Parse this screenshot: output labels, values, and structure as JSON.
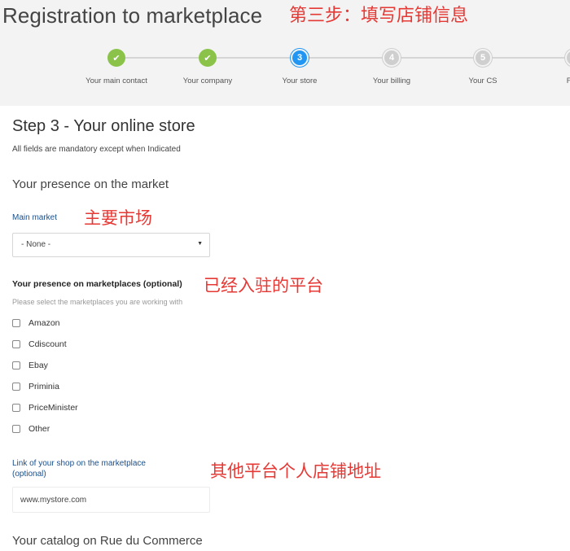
{
  "header": {
    "title": "Registration to marketplace",
    "annotation": "第三步：填写店铺信息"
  },
  "stepper": {
    "steps": [
      {
        "label": "Your main contact",
        "state": "done",
        "marker": "✔"
      },
      {
        "label": "Your company",
        "state": "done",
        "marker": "✔"
      },
      {
        "label": "Your store",
        "state": "active",
        "marker": "3"
      },
      {
        "label": "Your billing",
        "state": "todo",
        "marker": "4"
      },
      {
        "label": "Your CS",
        "state": "todo",
        "marker": "5"
      },
      {
        "label": "Fina",
        "state": "todo",
        "marker": ""
      }
    ],
    "colors": {
      "done": "#8bc34a",
      "active": "#2196f3",
      "todo": "#cfcfcf"
    }
  },
  "form": {
    "step_title": "Step 3 - Your online store",
    "mandatory_note": "All fields are mandatory except when Indicated",
    "presence_section": "Your presence on the market",
    "main_market": {
      "label": "Main market",
      "annotation": "主要市场",
      "selected": "- None -"
    },
    "marketplaces": {
      "label": "Your presence on marketplaces (optional)",
      "annotation": "已经入驻的平台",
      "hint": "Please select the marketplaces you are working with",
      "options": [
        {
          "label": "Amazon",
          "checked": false
        },
        {
          "label": "Cdiscount",
          "checked": false
        },
        {
          "label": "Ebay",
          "checked": false
        },
        {
          "label": "Priminia",
          "checked": false
        },
        {
          "label": "PriceMinister",
          "checked": false
        },
        {
          "label": "Other",
          "checked": false
        }
      ]
    },
    "shop_link": {
      "label": "Link of your shop on the marketplace (optional)",
      "annotation": "其他平台个人店铺地址",
      "value": "www.mystore.com"
    },
    "catalog_section": "Your catalog on Rue du Commerce"
  }
}
